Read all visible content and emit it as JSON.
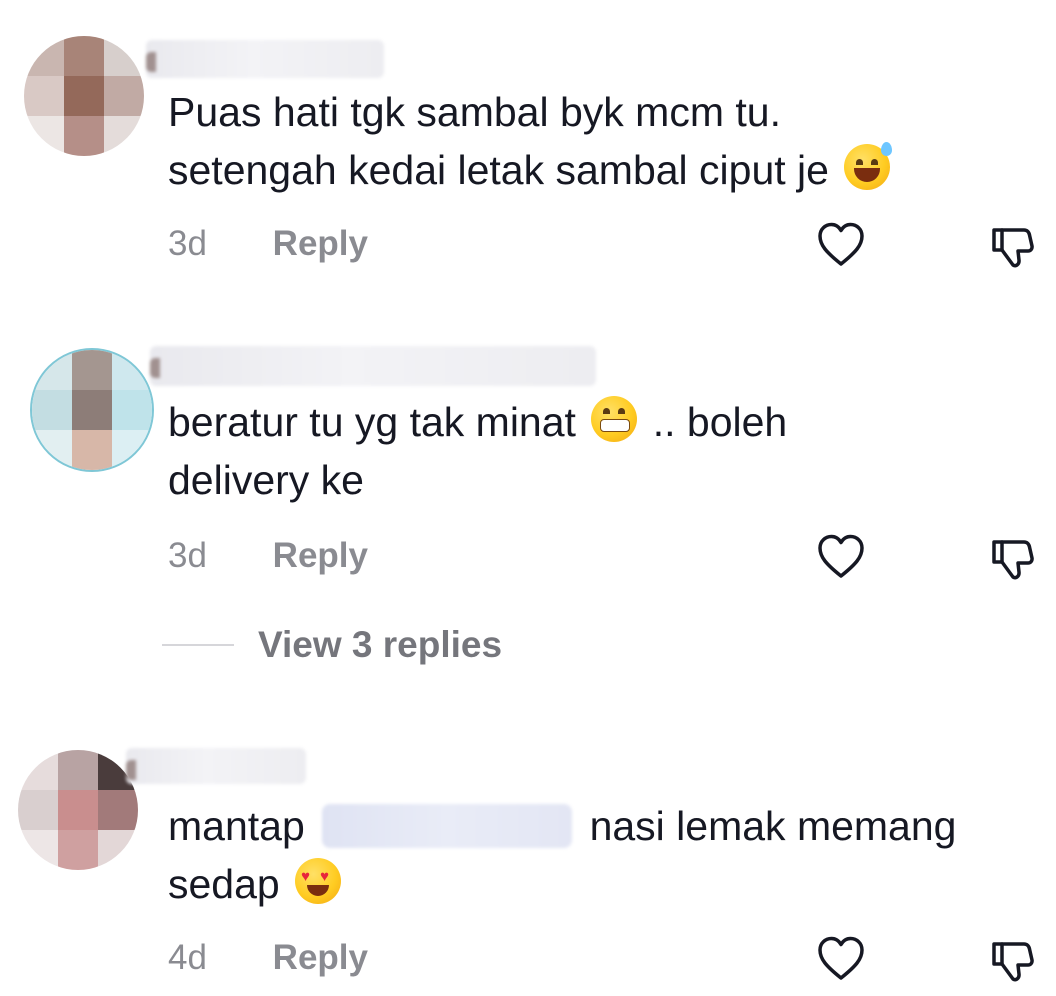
{
  "comments": [
    {
      "text_line1": "Puas hati tgk sambal byk mcm tu.",
      "text_line2": "setengah kedai letak sambal ciput je",
      "emoji": "grinning-sweat-emoji",
      "time": "3d",
      "reply_label": "Reply"
    },
    {
      "text_line1_a": "beratur tu yg tak minat",
      "text_line1_b": ".. boleh",
      "text_line2": "delivery ke",
      "emoji": "grimacing-emoji",
      "time": "3d",
      "reply_label": "Reply",
      "view_replies": "View 3 replies"
    },
    {
      "text_line1_a": "mantap",
      "text_line1_b": "nasi lemak memang",
      "text_line2": "sedap",
      "emoji": "heart-eyes-emoji",
      "time": "4d",
      "reply_label": "Reply"
    }
  ],
  "icons": {
    "like": "heart-outline-icon",
    "dislike": "thumbs-down-icon"
  },
  "colors": {
    "text": "#161823",
    "meta": "#8a8b91",
    "icon": "#161823"
  }
}
